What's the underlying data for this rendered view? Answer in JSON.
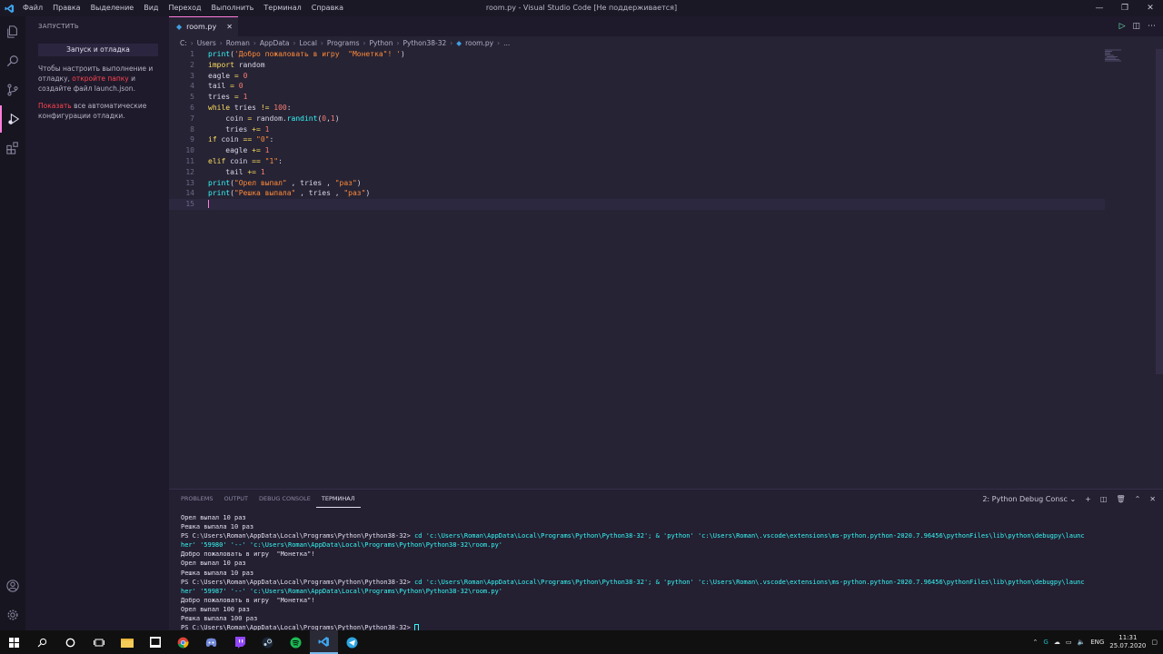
{
  "window": {
    "title": "room.py - Visual Studio Code [Не поддерживается]",
    "menu": [
      "Файл",
      "Правка",
      "Выделение",
      "Вид",
      "Переход",
      "Выполнить",
      "Терминал",
      "Справка"
    ]
  },
  "sidebar": {
    "header": "ЗАПУСТИТЬ",
    "run_button": "Запуск и отладка",
    "text1_a": "Чтобы настроить выполнение и отладку,",
    "text1_link": "откройте папку",
    "text1_b": "и создайте файл launch.json.",
    "text2_link": "Показать",
    "text2_b": "все автоматические конфигурации отладки."
  },
  "tab": {
    "label": "room.py",
    "close": "✕"
  },
  "breadcrumb": [
    "C:",
    "Users",
    "Roman",
    "AppData",
    "Local",
    "Programs",
    "Python",
    "Python38-32",
    "room.py",
    "..."
  ],
  "code": {
    "line_numbers": [
      "1",
      "2",
      "3",
      "4",
      "5",
      "6",
      "7",
      "8",
      "9",
      "10",
      "11",
      "12",
      "13",
      "14",
      "15"
    ]
  },
  "panel": {
    "tabs": [
      "PROBLEMS",
      "OUTPUT",
      "DEBUG CONSOLE",
      "ТЕРМИНАЛ"
    ],
    "terminal_select": "2: Python Debug Consc",
    "lines": [
      "Орел выпал 10 раз",
      "Решка выпала 10 раз",
      "PS C:\\Users\\Roman\\AppData\\Local\\Programs\\Python\\Python38-32>",
      " cd 'c:\\Users\\Roman\\AppData\\Local\\Programs\\Python\\Python38-32'; & 'python' 'c:\\Users\\Roman\\.vscode\\extensions\\ms-python.python-2020.7.96456\\pythonFiles\\lib\\python\\debugpy\\launc",
      "her' '59980' '--' 'c:\\Users\\Roman\\AppData\\Local\\Programs\\Python\\Python38-32\\room.py'",
      "Добро пожаловать в игру  \"Монетка\"!",
      "Орел выпал 10 раз",
      "Решка выпала 10 раз",
      " cd 'c:\\Users\\Roman\\AppData\\Local\\Programs\\Python\\Python38-32'; & 'python' 'c:\\Users\\Roman\\.vscode\\extensions\\ms-python.python-2020.7.96456\\pythonFiles\\lib\\python\\debugpy\\launc",
      "her' '59987' '--' 'c:\\Users\\Roman\\AppData\\Local\\Programs\\Python\\Python38-32\\room.py'",
      "Добро пожаловать в игру  \"Монетка\"!",
      "Орел выпал 100 раз",
      "Решка выпала 100 раз"
    ]
  },
  "taskbar": {
    "lang": "ENG",
    "time": "11:31",
    "date": "25.07.2020"
  }
}
